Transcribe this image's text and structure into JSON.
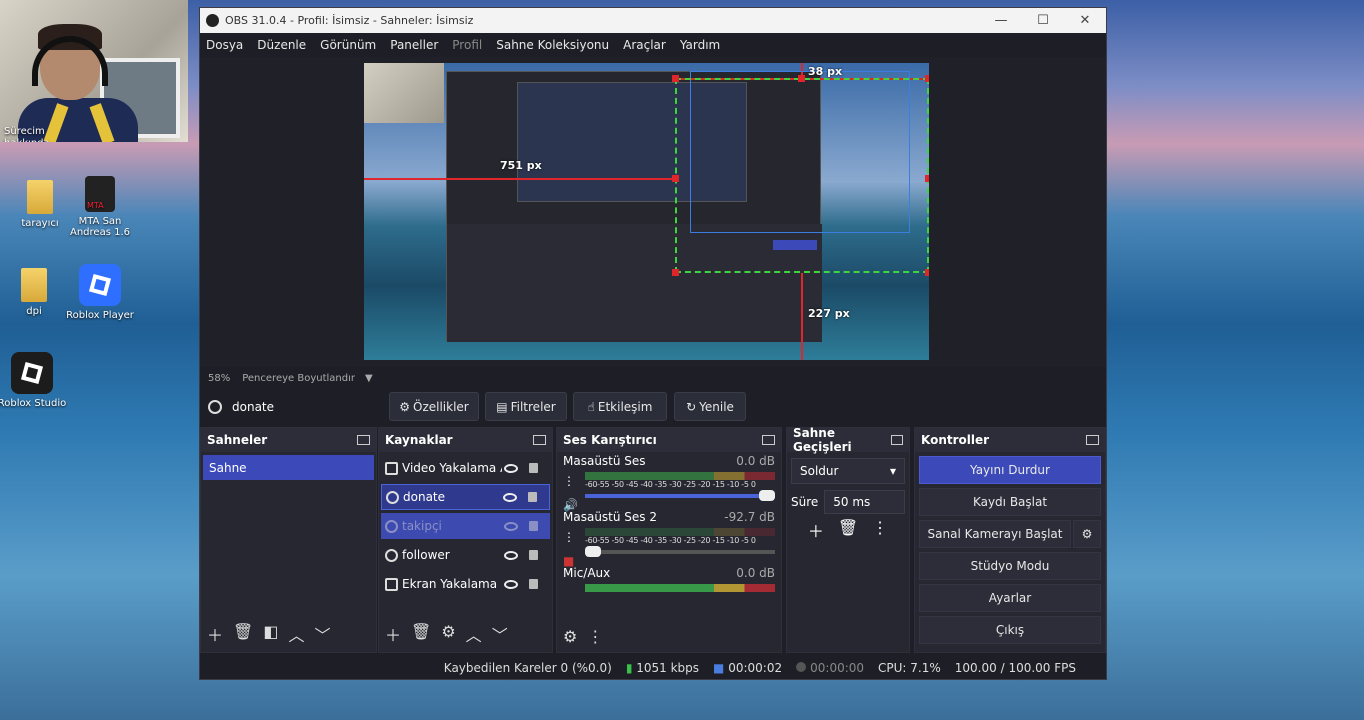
{
  "desktop": {
    "webcam_label": "Sürecim hakkında ...",
    "icons": [
      {
        "label": "tarayıcı",
        "type": "folder"
      },
      {
        "label": "MTA San Andreas 1.6",
        "type": "app"
      },
      {
        "label": "dpi",
        "type": "folder"
      },
      {
        "label": "Roblox Player",
        "type": "app"
      },
      {
        "label": "Roblox Studio",
        "type": "app"
      }
    ],
    "mta_badge": "MTA"
  },
  "window": {
    "title": "OBS 31.0.4 - Profil: İsimsiz - Sahneler: İsimsiz",
    "minimize": "—",
    "maximize": "☐",
    "close": "✕"
  },
  "menu": [
    "Dosya",
    "Düzenle",
    "Görünüm",
    "Paneller",
    "Profil",
    "Sahne Koleksiyonu",
    "Araçlar",
    "Yardım"
  ],
  "preview": {
    "labels": {
      "top": "38 px",
      "left": "751 px",
      "bottom": "227 px"
    },
    "zoom": "58%",
    "fit_label": "Pencereye Boyutlandır"
  },
  "source_toolbar": {
    "source_name": "donate",
    "buttons": [
      "Özellikler",
      "Filtreler",
      "Etkileşim",
      "Yenile"
    ]
  },
  "docks": {
    "scenes": {
      "title": "Sahneler",
      "items": [
        "Sahne"
      ]
    },
    "sources": {
      "title": "Kaynaklar",
      "items": [
        {
          "name": "Video Yakalama Ay",
          "state": "normal"
        },
        {
          "name": "donate",
          "state": "selected"
        },
        {
          "name": "takipçi",
          "state": "hidden"
        },
        {
          "name": "follower",
          "state": "normal"
        },
        {
          "name": "Ekran Yakalama",
          "state": "normal"
        }
      ]
    },
    "mixer": {
      "title": "Ses Karıştırıcı",
      "ticks": "-60-55 -50 -45 -40 -35 -30 -25 -20 -15 -10 -5 0",
      "channels": [
        {
          "name": "Masaüstü Ses",
          "db": "0.0 dB"
        },
        {
          "name": "Masaüstü Ses 2",
          "db": "-92.7 dB"
        },
        {
          "name": "Mic/Aux",
          "db": "0.0 dB"
        }
      ]
    },
    "transitions": {
      "title": "Sahne Geçişleri",
      "selected": "Soldur",
      "duration_label": "Süre",
      "duration": "50 ms"
    },
    "controls": {
      "title": "Kontroller",
      "buttons": [
        "Yayını Durdur",
        "Kaydı Başlat",
        "Sanal Kamerayı Başlat",
        "Stüdyo Modu",
        "Ayarlar",
        "Çıkış"
      ]
    }
  },
  "status": {
    "dropped": "Kaybedilen Kareler 0 (%0.0)",
    "bitrate": "1051 kbps",
    "stream_time": "00:00:02",
    "rec_time": "00:00:00",
    "cpu": "CPU: 7.1%",
    "fps": "100.00 / 100.00 FPS"
  }
}
